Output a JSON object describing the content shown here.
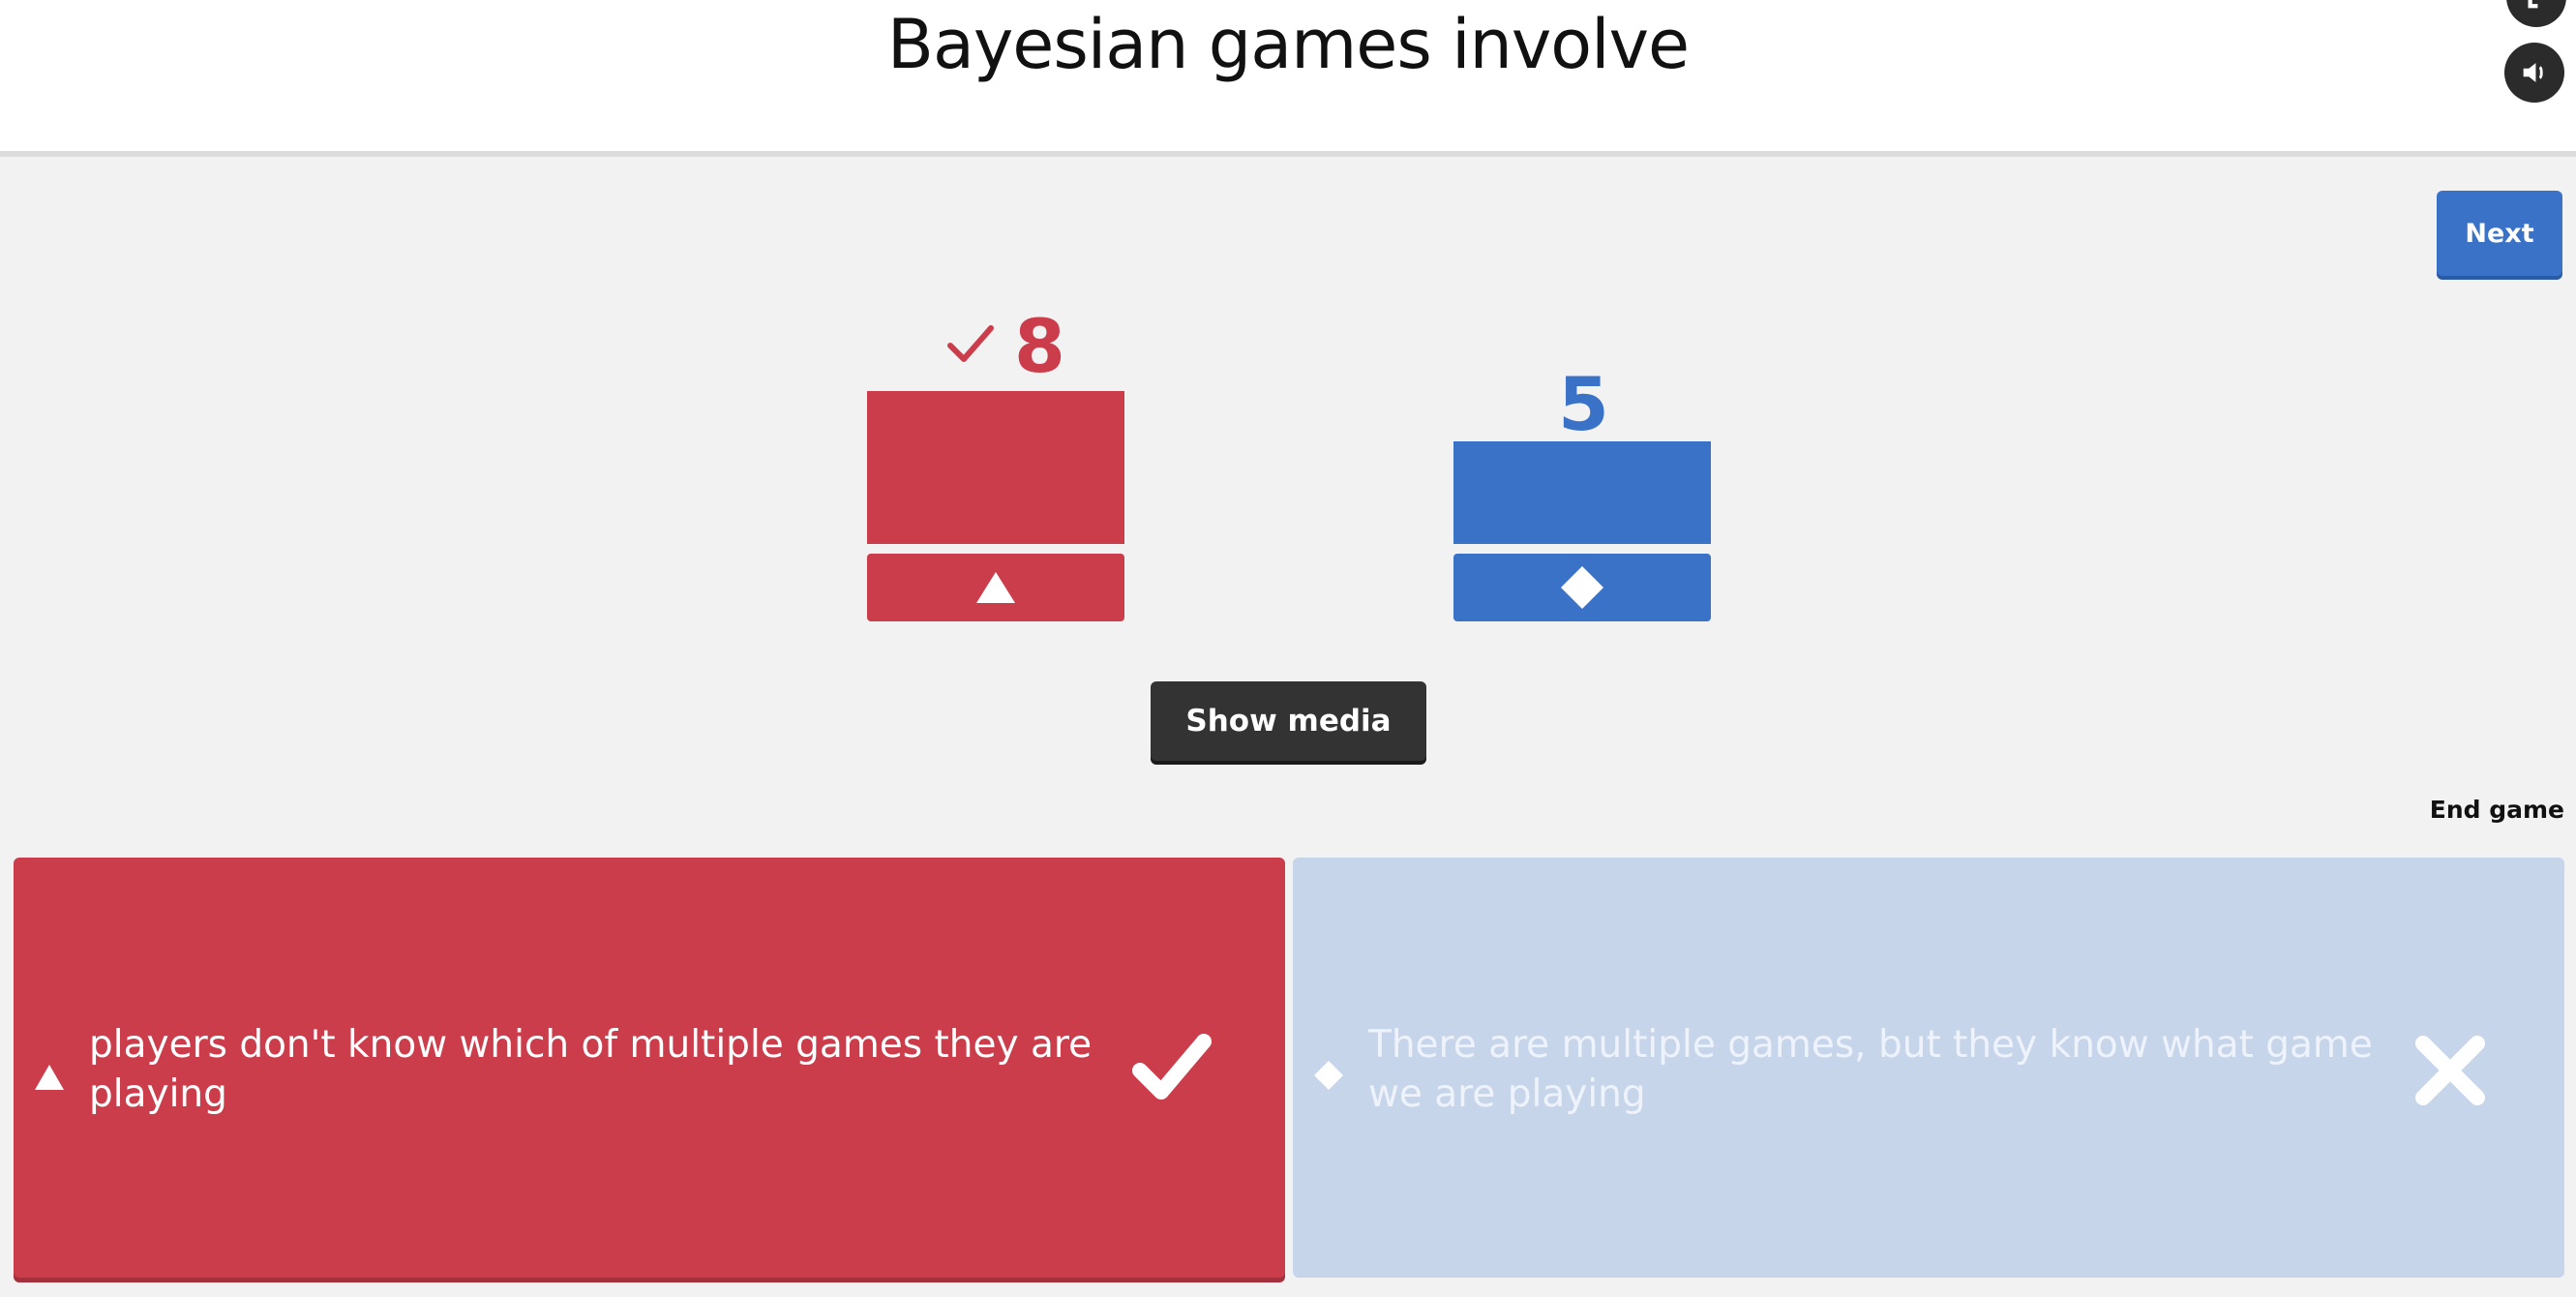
{
  "question": {
    "text": "Bayesian games involve"
  },
  "controls": {
    "next_label": "Next",
    "show_media_label": "Show media",
    "end_game_label": "End game"
  },
  "icons": {
    "top_button": "exit-icon",
    "sound_button": "speaker-icon"
  },
  "results": [
    {
      "shape": "triangle",
      "count": "8",
      "correct": true,
      "color": "#cc3d4b"
    },
    {
      "shape": "diamond",
      "count": "5",
      "correct": false,
      "color": "#3a72c8"
    }
  ],
  "answers": [
    {
      "shape": "triangle",
      "text": "players don't know which of multiple games they are playing",
      "correct": true,
      "color": "#cc3d4b"
    },
    {
      "shape": "diamond",
      "text": "There are multiple games, but they know what game we are playing",
      "correct": false,
      "color": "#c7d5eb"
    }
  ]
}
